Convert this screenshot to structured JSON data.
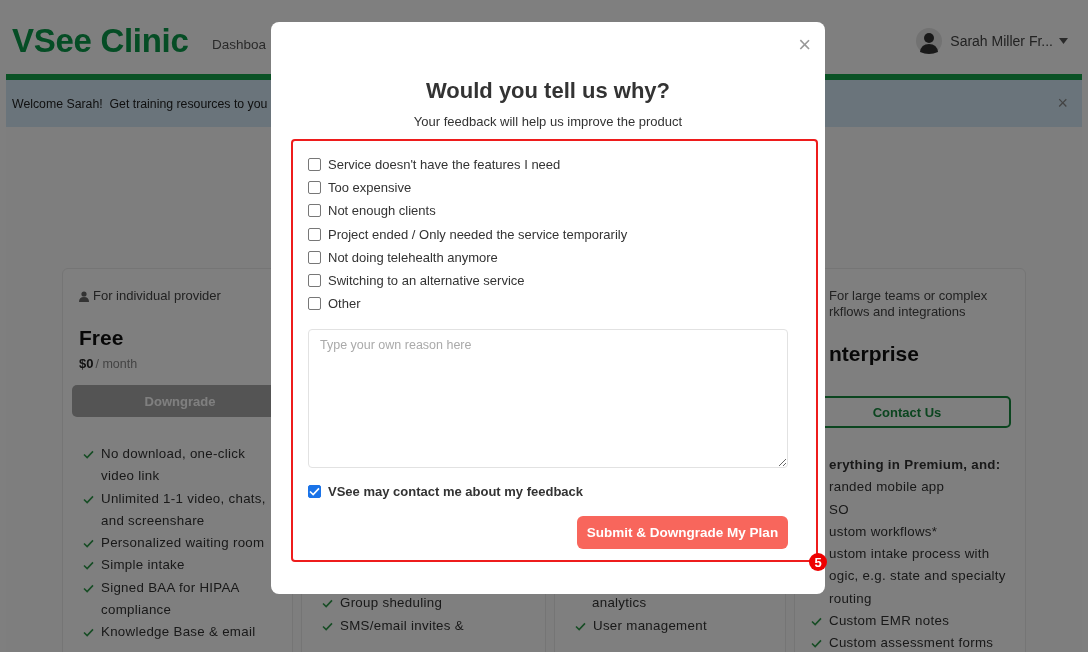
{
  "header": {
    "logo": "VSee Clinic",
    "nav": [
      "Dashboa"
    ],
    "user": "Sarah Miller Fr..."
  },
  "banner": {
    "text": "Welcome Sarah!  Get training resources to you",
    "close": "×"
  },
  "plans": [
    {
      "audience": [
        "For individual provider"
      ],
      "name": "Free",
      "price": "$0",
      "period": "/ month",
      "button": {
        "label": "Downgrade",
        "kind": "filled"
      },
      "features": [
        {
          "kind": "check",
          "lines": [
            "No download, one-click",
            "video link"
          ]
        },
        {
          "kind": "check",
          "lines": [
            "Unlimited 1-1 video, chats,",
            "and screenshare"
          ]
        },
        {
          "kind": "check",
          "lines": [
            "Personalized waiting room"
          ]
        },
        {
          "kind": "check",
          "lines": [
            "Simple intake"
          ]
        },
        {
          "kind": "check",
          "lines": [
            "Signed BAA for HIPAA",
            "compliance"
          ]
        },
        {
          "kind": "check",
          "lines": [
            "Knowledge Base & email"
          ]
        }
      ]
    },
    {
      "features": [
        {
          "kind": "check",
          "lines": [
            "Group sheduling"
          ]
        },
        {
          "kind": "check",
          "lines": [
            "SMS/email invites &"
          ]
        }
      ]
    },
    {
      "features": [
        {
          "kind": "text",
          "lines": [
            "analytics"
          ]
        },
        {
          "kind": "check",
          "lines": [
            "User management"
          ]
        }
      ]
    },
    {
      "audience": [
        "For large teams or complex",
        "rkflows and integrations"
      ],
      "name": "nterprise",
      "button": {
        "label": "Contact Us",
        "kind": "outline"
      },
      "features": [
        {
          "kind": "heading",
          "lines": [
            "erything in Premium, and:"
          ]
        },
        {
          "kind": "text",
          "lines": [
            "randed mobile app"
          ]
        },
        {
          "kind": "text",
          "lines": [
            "SO"
          ]
        },
        {
          "kind": "text",
          "lines": [
            "ustom workflows*"
          ]
        },
        {
          "kind": "text",
          "lines": [
            "ustom intake process with",
            "ogic, e.g. state and specialty",
            "routing"
          ]
        },
        {
          "kind": "check",
          "lines": [
            "Custom EMR notes"
          ]
        },
        {
          "kind": "check",
          "lines": [
            "Custom assessment forms"
          ]
        }
      ]
    }
  ],
  "modal": {
    "close": "×",
    "title": "Would you tell us why?",
    "subtitle": "Your feedback will help us improve the product",
    "reasons": [
      {
        "label": "Service doesn't have the features I need",
        "checked": false
      },
      {
        "label": "Too expensive",
        "checked": false
      },
      {
        "label": "Not enough clients",
        "checked": false
      },
      {
        "label": "Project ended / Only needed the service temporarily",
        "checked": false
      },
      {
        "label": "Not doing telehealth anymore",
        "checked": false
      },
      {
        "label": "Switching to an alternative service",
        "checked": false
      },
      {
        "label": "Other",
        "checked": false
      }
    ],
    "reason_field": {
      "placeholder": "Type your own reason here"
    },
    "contact": {
      "label": "VSee may contact me about my feedback",
      "checked": true
    },
    "submit": "Submit & Downgrade My Plan",
    "annotation": "5"
  }
}
